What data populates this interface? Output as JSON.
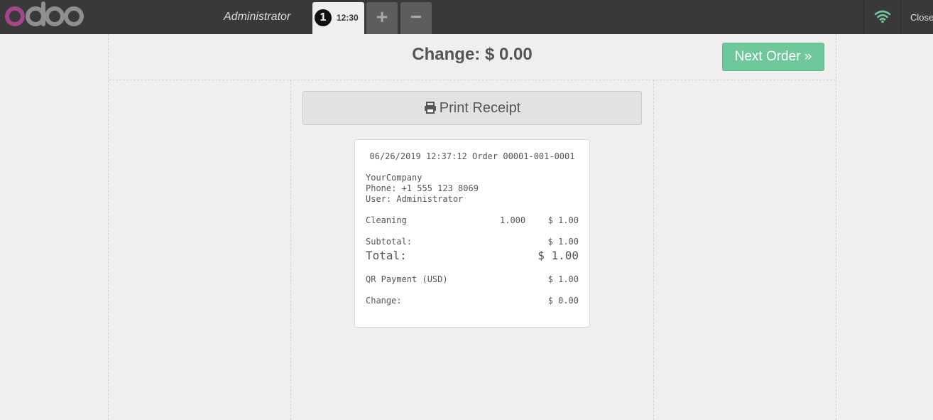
{
  "header": {
    "logo_text": "odoo",
    "username": "Administrator",
    "order_tab": {
      "sequence": "1",
      "time": "12:30"
    },
    "add_button": "+",
    "remove_button": "−",
    "close_label": "Close"
  },
  "payment_screen": {
    "change_title": "Change: $ 0.00",
    "next_order_label": "Next Order »",
    "print_receipt_label": "Print Receipt"
  },
  "receipt": {
    "header_line": "06/26/2019 12:37:12 Order 00001-001-0001",
    "company": "YourCompany",
    "phone": "Phone: +1 555 123 8069",
    "user": "User: Administrator",
    "lines": [
      {
        "product": "Cleaning",
        "qty": "1.000",
        "price": "$ 1.00"
      }
    ],
    "subtotal_label": "Subtotal:",
    "subtotal_value": "$ 1.00",
    "total_label": "Total:",
    "total_value": "$ 1.00",
    "payment_label": "QR Payment (USD)",
    "payment_value": "$ 1.00",
    "change_label": "Change:",
    "change_value": "$ 0.00"
  },
  "colors": {
    "topbar": "#393939",
    "background": "#f0eeee",
    "accent_green": "#6ec89b",
    "wifi_ok": "#6ec89b",
    "logo_purple": "#a24689",
    "logo_gray": "#8f8f8f"
  }
}
